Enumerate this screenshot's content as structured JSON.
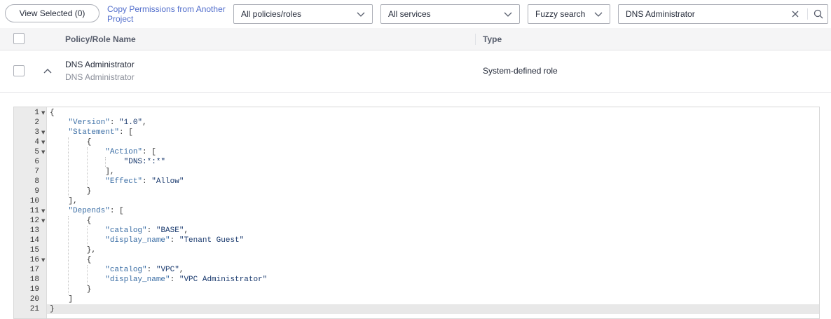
{
  "toolbar": {
    "view_selected_label": "View Selected (0)",
    "copy_permissions_label": "Copy Permissions from Another Project",
    "policy_filter": "All policies/roles",
    "service_filter": "All services",
    "search_mode": "Fuzzy search",
    "search_value": "DNS Administrator"
  },
  "table": {
    "columns": [
      "Policy/Role Name",
      "Type"
    ],
    "rows": [
      {
        "name": "DNS Administrator",
        "description": "DNS Administrator",
        "type": "System-defined role"
      }
    ]
  },
  "editor": {
    "lines": [
      {
        "n": "1",
        "fold": true,
        "text": "{"
      },
      {
        "n": "2",
        "fold": false,
        "text": "    \"Version\": \"1.0\","
      },
      {
        "n": "3",
        "fold": true,
        "text": "    \"Statement\": ["
      },
      {
        "n": "4",
        "fold": true,
        "text": "        {"
      },
      {
        "n": "5",
        "fold": true,
        "text": "            \"Action\": ["
      },
      {
        "n": "6",
        "fold": false,
        "text": "                \"DNS:*:*\""
      },
      {
        "n": "7",
        "fold": false,
        "text": "            ],"
      },
      {
        "n": "8",
        "fold": false,
        "text": "            \"Effect\": \"Allow\""
      },
      {
        "n": "9",
        "fold": false,
        "text": "        }"
      },
      {
        "n": "10",
        "fold": false,
        "text": "    ],"
      },
      {
        "n": "11",
        "fold": true,
        "text": "    \"Depends\": ["
      },
      {
        "n": "12",
        "fold": true,
        "text": "        {"
      },
      {
        "n": "13",
        "fold": false,
        "text": "            \"catalog\": \"BASE\","
      },
      {
        "n": "14",
        "fold": false,
        "text": "            \"display_name\": \"Tenant Guest\""
      },
      {
        "n": "15",
        "fold": false,
        "text": "        },"
      },
      {
        "n": "16",
        "fold": true,
        "text": "        {"
      },
      {
        "n": "17",
        "fold": false,
        "text": "            \"catalog\": \"VPC\","
      },
      {
        "n": "18",
        "fold": false,
        "text": "            \"display_name\": \"VPC Administrator\""
      },
      {
        "n": "19",
        "fold": false,
        "text": "        }"
      },
      {
        "n": "20",
        "fold": false,
        "text": "    ]"
      },
      {
        "n": "21",
        "fold": false,
        "text": "}"
      }
    ],
    "active_line": "21"
  },
  "colors": {
    "accent": "#526ecc",
    "key": "#3b6ea5",
    "string": "#1a3a6e"
  }
}
